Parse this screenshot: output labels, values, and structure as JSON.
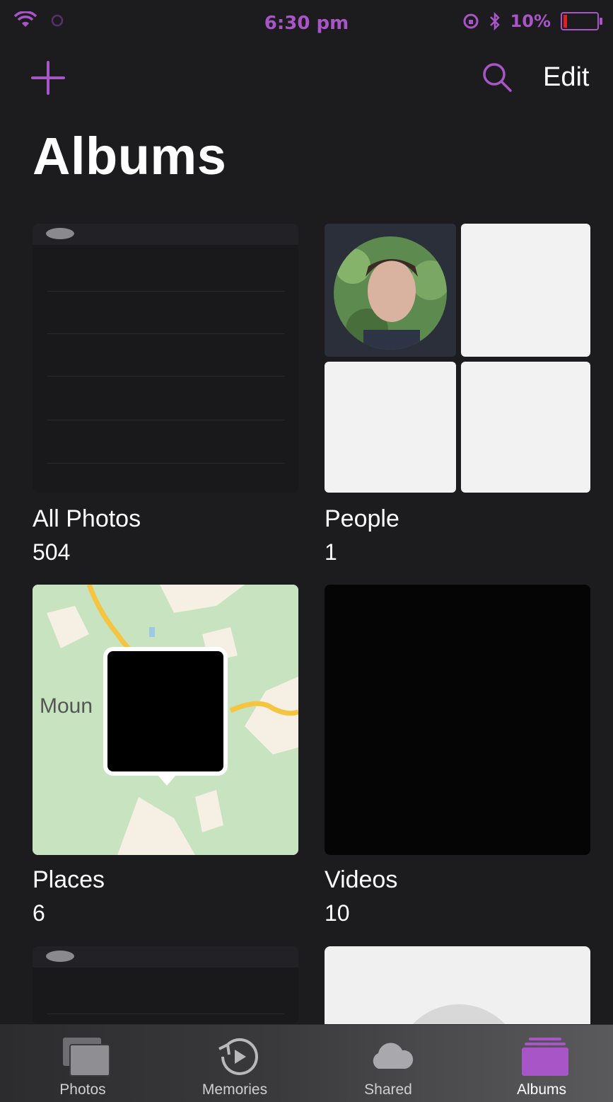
{
  "status_bar": {
    "time": "6:30 pm",
    "battery_text": "10%",
    "battery_level_percent": 10
  },
  "nav": {
    "edit_label": "Edit"
  },
  "page": {
    "title": "Albums"
  },
  "albums": [
    {
      "title": "All Photos",
      "count": "504"
    },
    {
      "title": "People",
      "count": "1"
    },
    {
      "title": "Places",
      "count": "6",
      "map_label": "Moun"
    },
    {
      "title": "Videos",
      "count": "10"
    }
  ],
  "tab_bar": {
    "tabs": [
      {
        "label": "Photos",
        "icon": "photos-icon"
      },
      {
        "label": "Memories",
        "icon": "memories-icon"
      },
      {
        "label": "Shared",
        "icon": "cloud-icon"
      },
      {
        "label": "Albums",
        "icon": "albums-icon"
      }
    ],
    "active_tab": "Albums"
  },
  "colors": {
    "accent": "#a855c7",
    "background": "#1c1c1e",
    "battery_low": "#e02020"
  }
}
